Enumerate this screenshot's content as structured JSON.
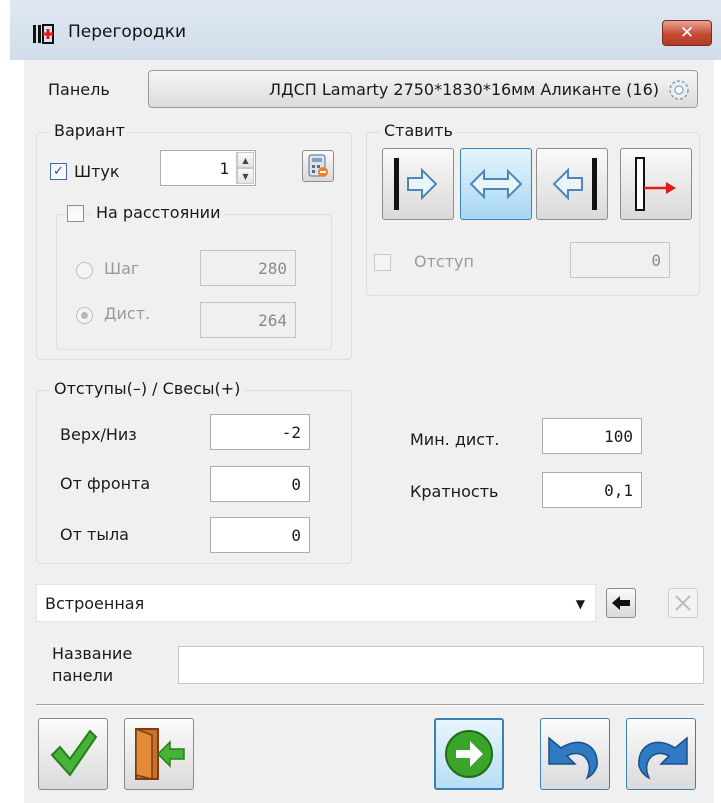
{
  "window": {
    "title": "Перегородки",
    "close_glyph": "✕"
  },
  "panel": {
    "label": "Панель",
    "value": "ЛДСП Lamarty 2750*1830*16мм Аликанте (16)",
    "icon": "gear-icon"
  },
  "variant": {
    "title": "Вариант",
    "count_label": "Штук",
    "count_checked": true,
    "count_value": "1",
    "calc_icon": "calculator-icon",
    "distance_label": "На расстоянии",
    "distance_checked": false,
    "step_label": "Шаг",
    "step_value": "280",
    "dist_label": "Дист.",
    "dist_value": "264",
    "selected_radio": "dist"
  },
  "place": {
    "title": "Ставить",
    "buttons": [
      {
        "name": "place-from-left-button",
        "icon": "arrow-right-from-wall-icon",
        "active": false
      },
      {
        "name": "place-center-button",
        "icon": "double-arrow-icon",
        "active": true
      },
      {
        "name": "place-from-right-button",
        "icon": "arrow-left-to-wall-icon",
        "active": false
      },
      {
        "name": "place-outside-button",
        "icon": "red-arrow-out-icon",
        "active": false
      }
    ],
    "offset_label": "Отступ",
    "offset_checked": false,
    "offset_value": "0"
  },
  "offsets": {
    "title": "Отступы(–) / Свесы(+)",
    "top_bottom_label": "Верх/Низ",
    "top_bottom_value": "-2",
    "front_label": "От фронта",
    "front_value": "0",
    "back_label": "От тыла",
    "back_value": "0"
  },
  "min_dist": {
    "label": "Мин. дист.",
    "value": "100"
  },
  "multiplicity": {
    "label": "Кратность",
    "value": "0,1"
  },
  "preset": {
    "value": "Встроенная",
    "arrow": "▼",
    "apply_icon": "arrow-left-icon",
    "delete_icon": "close-icon"
  },
  "panel_name": {
    "label_line1": "Название",
    "label_line2": "панели",
    "value": ""
  },
  "footer": {
    "ok_icon": "checkmark-icon",
    "exit_icon": "exit-door-icon",
    "next_icon": "green-arrow-right-icon",
    "undo_icon": "undo-icon",
    "redo_icon": "redo-icon"
  },
  "colors": {
    "accent": "#3c7fb1",
    "close": "#c64b33",
    "ok_green": "#3aa52a",
    "arrow_red": "#e01b1b"
  }
}
